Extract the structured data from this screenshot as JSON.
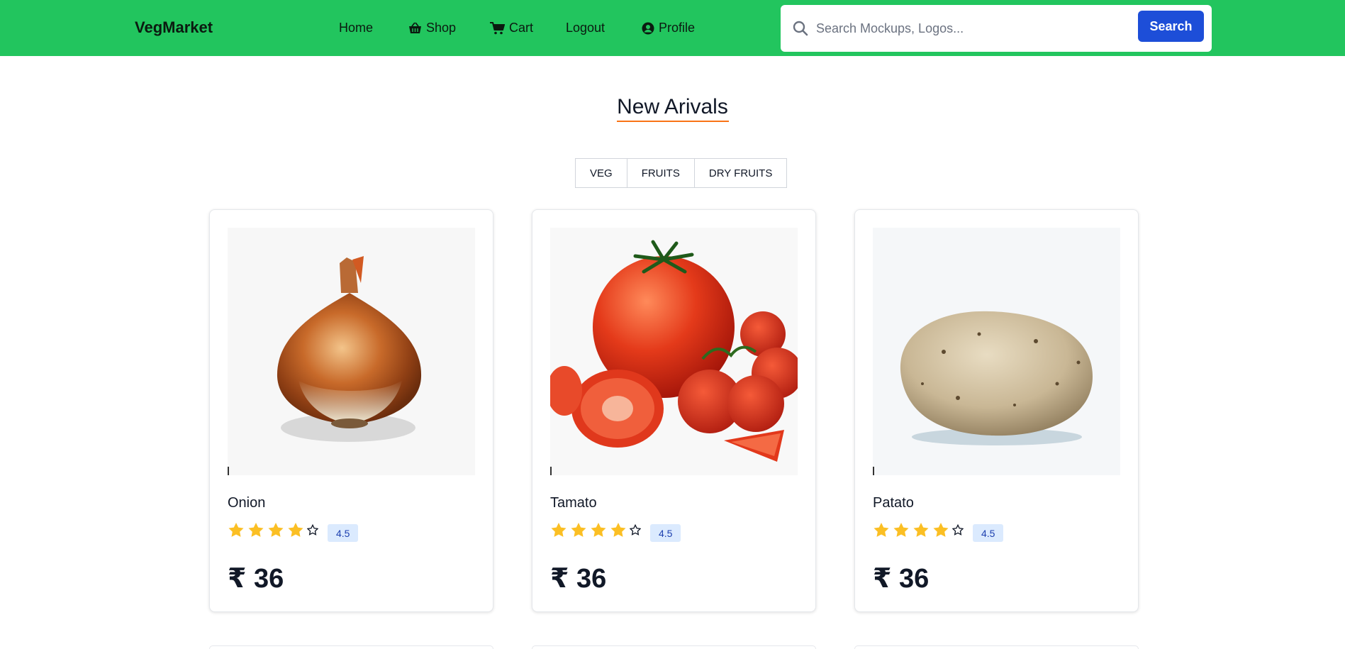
{
  "navbar": {
    "brand": "VegMarket",
    "links": [
      {
        "label": "Home",
        "icon": ""
      },
      {
        "label": "Shop",
        "icon": "basket-icon"
      },
      {
        "label": "Cart",
        "icon": "cart-icon"
      },
      {
        "label": "Logout",
        "icon": ""
      },
      {
        "label": "Profile",
        "icon": "user-circle-icon"
      }
    ],
    "search": {
      "placeholder": "Search Mockups, Logos...",
      "value": "",
      "button_label": "Search"
    }
  },
  "section": {
    "title": "New Arivals",
    "filters": [
      "VEG",
      "FRUITS",
      "DRY FRUITS"
    ]
  },
  "products": [
    {
      "name": "Onion",
      "rating": "4.5",
      "stars_filled": 4,
      "stars_total": 5,
      "price": "₹ 36",
      "image": "onion-image"
    },
    {
      "name": "Tamato",
      "rating": "4.5",
      "stars_filled": 4,
      "stars_total": 5,
      "price": "₹ 36",
      "image": "tomato-image"
    },
    {
      "name": "Patato",
      "rating": "4.5",
      "stars_filled": 4,
      "stars_total": 5,
      "price": "₹ 36",
      "image": "potato-image"
    }
  ],
  "colors": {
    "navbar_bg": "#22c55e",
    "search_button": "#1d4ed8",
    "title_underline": "#f97316",
    "star": "#fbbf24",
    "badge_bg": "#dbeafe"
  }
}
